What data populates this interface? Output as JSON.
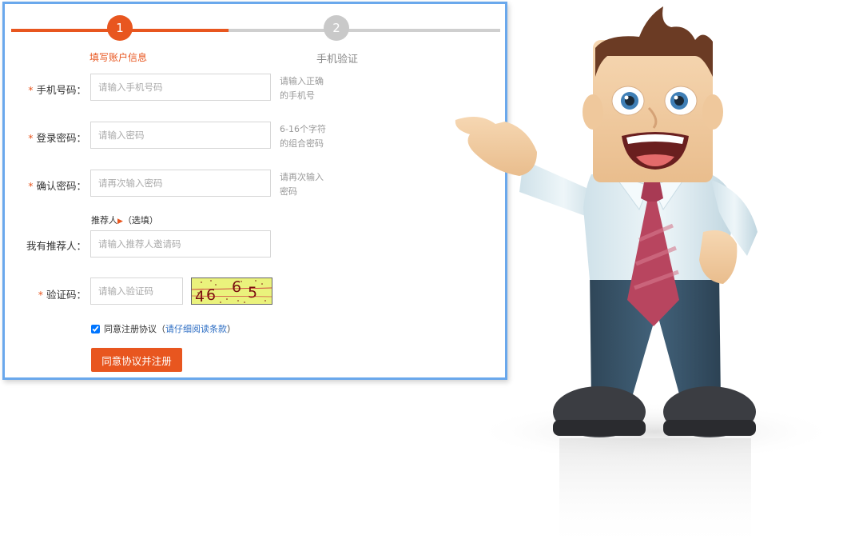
{
  "steps": [
    {
      "number": "1",
      "label": "填写账户信息",
      "active": true
    },
    {
      "number": "2",
      "label": "手机验证",
      "active": false
    }
  ],
  "form": {
    "phone": {
      "label": "手机号码：",
      "placeholder": "请输入手机号码",
      "hint": "请输入正确的手机号",
      "required": true
    },
    "password": {
      "label": "登录密码：",
      "placeholder": "请输入密码",
      "hint": "6-16个字符的组合密码",
      "required": true
    },
    "confirm": {
      "label": "确认密码：",
      "placeholder": "请再次输入密码",
      "hint": "请再次输入密码",
      "required": true
    },
    "referrer_toggle": "推荐人",
    "referrer_toggle_optional": "（选填）",
    "referrer": {
      "label": "我有推荐人：",
      "placeholder": "请输入推荐人邀请码"
    },
    "captcha": {
      "label": "验证码：",
      "placeholder": "请输入验证码",
      "image_text": "4665",
      "required": true
    },
    "agree": {
      "checked": true,
      "text": "同意注册协议",
      "open_paren": "（",
      "link": "请仔细阅读条款",
      "close_paren": "）"
    },
    "submit": "同意协议并注册",
    "required_mark": "*"
  },
  "colors": {
    "accent": "#e8561f",
    "border": "#6aa8ec",
    "link": "#2f6fc4",
    "captcha_bg": "#eaf27c"
  },
  "icons": {
    "arrow": "right-triangle",
    "mascot": "cartoon-businessman"
  }
}
